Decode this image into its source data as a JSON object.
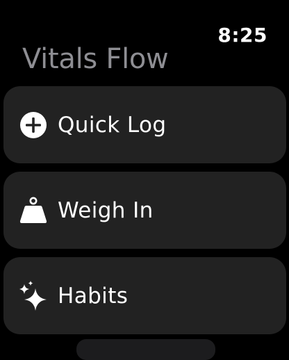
{
  "status": {
    "time": "8:25"
  },
  "app": {
    "title": "Vitals Flow"
  },
  "menu": {
    "items": [
      {
        "label": "Quick Log",
        "icon": "plus-circle-icon"
      },
      {
        "label": "Weigh In",
        "icon": "scale-weight-icon"
      },
      {
        "label": "Habits",
        "icon": "sparkles-icon"
      }
    ]
  },
  "colors": {
    "background": "#000000",
    "card": "#222222",
    "title": "#8e8e93",
    "text": "#ffffff"
  }
}
